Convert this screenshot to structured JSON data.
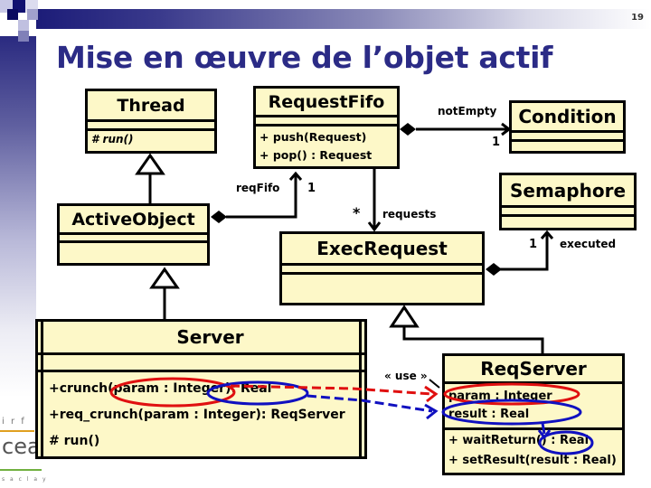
{
  "slide": {
    "number": "19",
    "title": "Mise en œuvre de l’objet actif",
    "logo": {
      "line1": "i r f",
      "line2": "cea",
      "line3": "s a c l a y"
    }
  },
  "classes": {
    "thread": {
      "name": "Thread",
      "operations": [
        "# run()"
      ]
    },
    "request_fifo": {
      "name": "RequestFifo",
      "operations": [
        "+ push(Request)",
        "+ pop() : Request"
      ]
    },
    "condition": {
      "name": "Condition"
    },
    "semaphore": {
      "name": "Semaphore"
    },
    "active_object": {
      "name": "ActiveObject"
    },
    "exec_request": {
      "name": "ExecRequest"
    },
    "server": {
      "name": "Server",
      "operations": [
        "+crunch(param : Integer): Real",
        "+req_crunch(param : Integer): ReqServer",
        "# run()"
      ]
    },
    "req_server": {
      "name": "ReqServer",
      "attributes": [
        "param : Integer",
        "result : Real"
      ],
      "operations": [
        "+ waitReturn() : Real",
        "+ setResult(result : Real)"
      ]
    }
  },
  "associations": {
    "not_empty": {
      "role": "notEmpty",
      "multiplicity": "1"
    },
    "req_fifo": {
      "role": "reqFifo",
      "multiplicity": "1"
    },
    "requests": {
      "role": "requests",
      "multiplicity": "*"
    },
    "executed": {
      "role": "executed",
      "multiplicity": "1"
    },
    "use": {
      "stereotype": "« use »"
    }
  },
  "colors": {
    "title": "#2b2b86",
    "class_fill": "#fdf8c8",
    "highlight_red": "#e01010",
    "highlight_blue": "#1010c0"
  }
}
